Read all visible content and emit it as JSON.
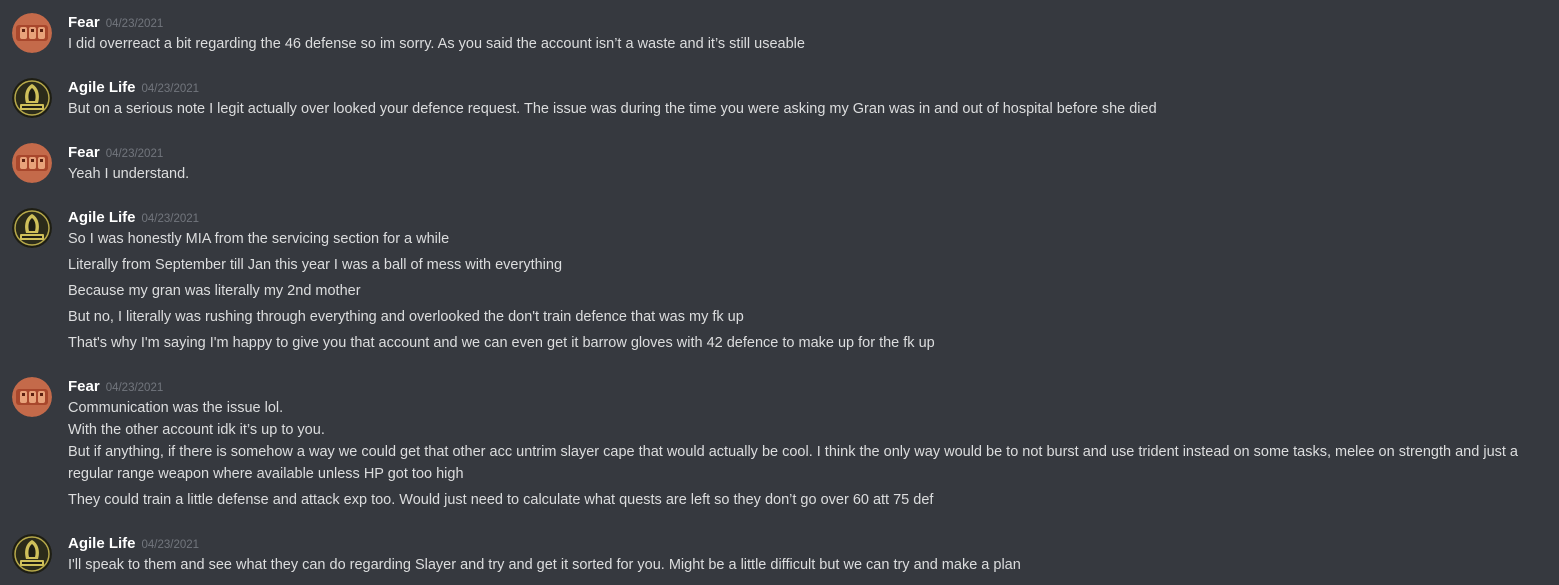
{
  "colors": {
    "background": "#36393f",
    "username": "#ffffff",
    "timestamp": "#72767d",
    "message_text": "#dcddde"
  },
  "messages": [
    {
      "author": "Fear",
      "avatar_icon": "fear-avatar-icon",
      "timestamp": "04/23/2021",
      "lines": [
        "I did overreact a bit regarding the 46 defense so im sorry. As you said the account isn’t a waste and it’s still useable"
      ]
    },
    {
      "author": "Agile Life",
      "avatar_icon": "agile-life-logo-avatar-icon",
      "timestamp": "04/23/2021",
      "lines": [
        "But on a serious note I legit actually over looked your defence request. The issue was during the time you were asking my Gran was in and out of hospital before she died"
      ]
    },
    {
      "author": "Fear",
      "avatar_icon": "fear-avatar-icon",
      "timestamp": "04/23/2021",
      "lines": [
        "Yeah I understand."
      ]
    },
    {
      "author": "Agile Life",
      "avatar_icon": "agile-life-logo-avatar-icon",
      "timestamp": "04/23/2021",
      "lines": [
        "So I was honestly MIA from the servicing section for a while",
        "Literally from September till Jan this year I was a ball of mess with everything",
        "Because my gran was literally my 2nd mother",
        "But no, I literally was rushing through everything and overlooked the don't train defence that was my fk up",
        "That's why I'm saying I'm happy to give you that account and we can even get it barrow gloves with 42 defence to make up for the fk up"
      ]
    },
    {
      "author": "Fear",
      "avatar_icon": "fear-avatar-icon",
      "timestamp": "04/23/2021",
      "lines": [
        "Communication was the issue lol.",
        "With the other account idk it’s up to you.",
        "But if anything, if there is somehow a way we could get that other acc untrim slayer cape that would actually be cool. I think the only way would be to not burst and use trident instead on some tasks, melee on strength and just a regular range weapon where available unless HP got too high",
        "They could train a little defense and attack exp too. Would just need to calculate what quests are left so they don’t go over 60 att 75 def"
      ]
    },
    {
      "author": "Agile Life",
      "avatar_icon": "agile-life-logo-avatar-icon",
      "timestamp": "04/23/2021",
      "lines": [
        "I'll speak to them and see what they can do regarding Slayer and try and get it sorted for you. Might be a little difficult but we can try and make a plan"
      ]
    }
  ]
}
